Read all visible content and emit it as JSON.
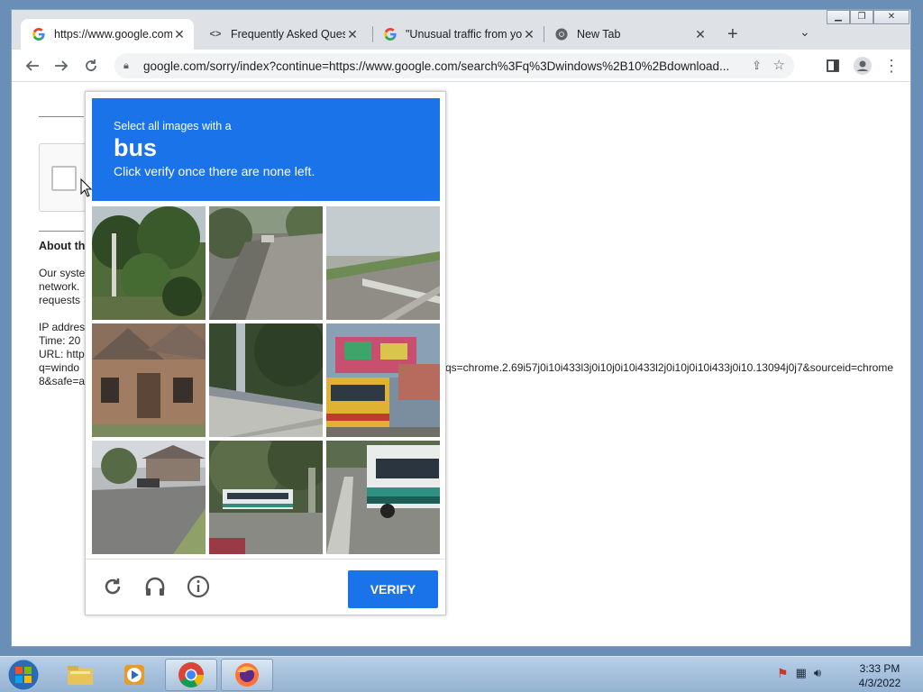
{
  "browser": {
    "tabs": [
      {
        "title": "https://www.google.com/sorry/index",
        "favicon": "google-g-icon",
        "active": true
      },
      {
        "title": "Frequently Asked Questions",
        "favicon": "code-icon",
        "active": false
      },
      {
        "title": "\"Unusual traffic from your computer\"",
        "favicon": "google-g-icon",
        "active": false
      },
      {
        "title": "New Tab",
        "favicon": "chrome-icon",
        "active": false
      }
    ],
    "address": "google.com/sorry/index?continue=https://www.google.com/search%3Fq%3Dwindows%2B10%2Bdownload..."
  },
  "page": {
    "about_heading": "About th",
    "para_lines": [
      "Our syste",
      "network.",
      "requests"
    ],
    "ip_lines": [
      "IP addres",
      "Time: 20",
      "URL: http",
      "q=windo",
      "8&safe=a"
    ],
    "url_tail": "qs=chrome.2.69i57j0i10i433l3j0i10j0i10i433l2j0i10j0i10i433j0i10.13094j0j7&sourceid=chrome"
  },
  "captcha": {
    "instruction_line1": "Select all images with a",
    "target_word": "bus",
    "instruction_line2": "Click verify once there are none left.",
    "verify_label": "VERIFY",
    "tiles": [
      {
        "name": "tile-trees"
      },
      {
        "name": "tile-road-curve"
      },
      {
        "name": "tile-highway-guardrail"
      },
      {
        "name": "tile-brick-house"
      },
      {
        "name": "tile-bridge"
      },
      {
        "name": "tile-painted-bus"
      },
      {
        "name": "tile-residential-street"
      },
      {
        "name": "tile-bus-distance"
      },
      {
        "name": "tile-bus-closeup"
      }
    ]
  },
  "taskbar": {
    "apps": [
      "explorer-icon",
      "media-player-icon",
      "chrome-icon",
      "firefox-icon"
    ],
    "time": "3:33 PM",
    "date": "4/3/2022"
  },
  "colors": {
    "accent": "#1a73e8"
  }
}
